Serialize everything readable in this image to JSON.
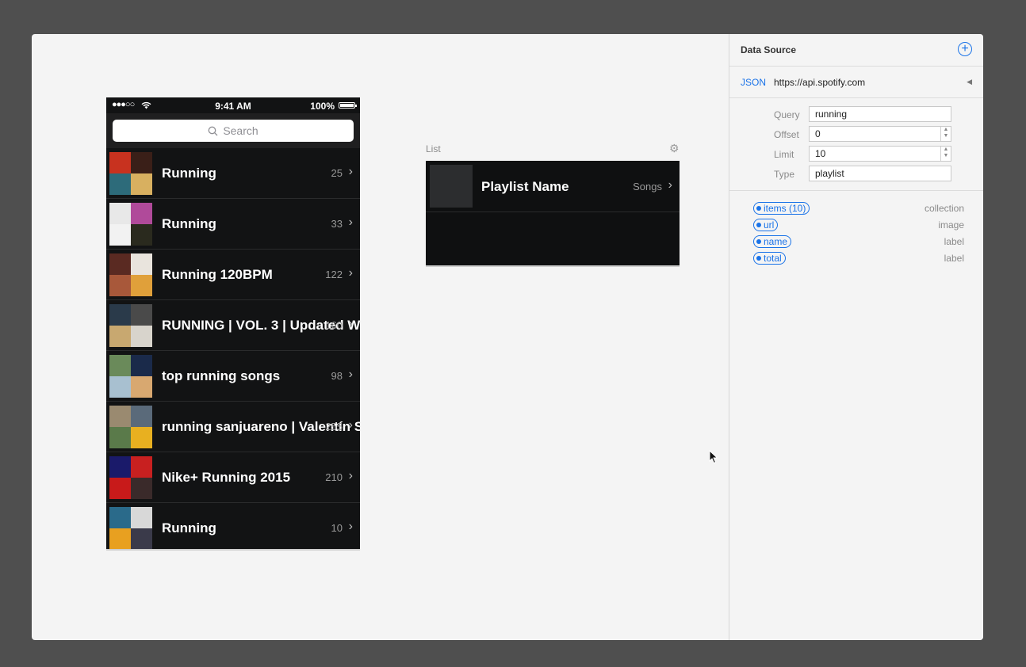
{
  "phone": {
    "status": {
      "signal": "●●●○○",
      "time": "9:41 AM",
      "battery": "100%"
    },
    "search_placeholder": "Search",
    "playlists": [
      {
        "name": "Running",
        "count": "25",
        "art": [
          "#c8321f",
          "#3a1f18",
          "#2d6b7a",
          "#d8b060"
        ]
      },
      {
        "name": "Running",
        "count": "33",
        "art": [
          "#e8e8e8",
          "#b04a9a",
          "#f2f2f2",
          "#2a2a1e"
        ]
      },
      {
        "name": "Running 120BPM",
        "count": "122",
        "art": [
          "#5a2a22",
          "#e9e4dd",
          "#a8583a",
          "#e0a03a"
        ]
      },
      {
        "name": "RUNNING | VOL. 3 | Updated W",
        "count": "160",
        "art": [
          "#2a3a4a",
          "#4a4a4a",
          "#c8a870",
          "#d8d4cc"
        ]
      },
      {
        "name": "top running songs",
        "count": "98",
        "art": [
          "#6a8a5a",
          "#1a2a4a",
          "#a8c0d0",
          "#d8a870"
        ]
      },
      {
        "name": "running sanjuareno | Valentín Sa",
        "count": "255",
        "art": [
          "#9a8a70",
          "#5a6a7a",
          "#5a7a4a",
          "#e8b020"
        ]
      },
      {
        "name": "Nike+ Running 2015",
        "count": "210",
        "art": [
          "#1a1a6a",
          "#c82020",
          "#c81a1a",
          "#3a2a2a"
        ]
      },
      {
        "name": "Running",
        "count": "10",
        "art": [
          "#2a6a8a",
          "#d8d8d8",
          "#e8a020",
          "#3a3a4a"
        ]
      }
    ]
  },
  "list": {
    "label": "List",
    "playlist_name": "Playlist Name",
    "songs": "Songs"
  },
  "panel": {
    "title": "Data Source",
    "source_type": "JSON",
    "source_url": "https://api.spotify.com",
    "params": [
      {
        "label": "Query",
        "value": "running"
      },
      {
        "label": "Offset",
        "value": "0"
      },
      {
        "label": "Limit",
        "value": "10"
      },
      {
        "label": "Type",
        "value": "playlist"
      }
    ],
    "fields": [
      {
        "name": "items (10)",
        "type": "collection"
      },
      {
        "name": "url",
        "type": "image"
      },
      {
        "name": "name",
        "type": "label"
      },
      {
        "name": "total",
        "type": "label"
      }
    ]
  },
  "colors": {
    "accent": "#1a73e8",
    "phone_bg": "#121314"
  }
}
